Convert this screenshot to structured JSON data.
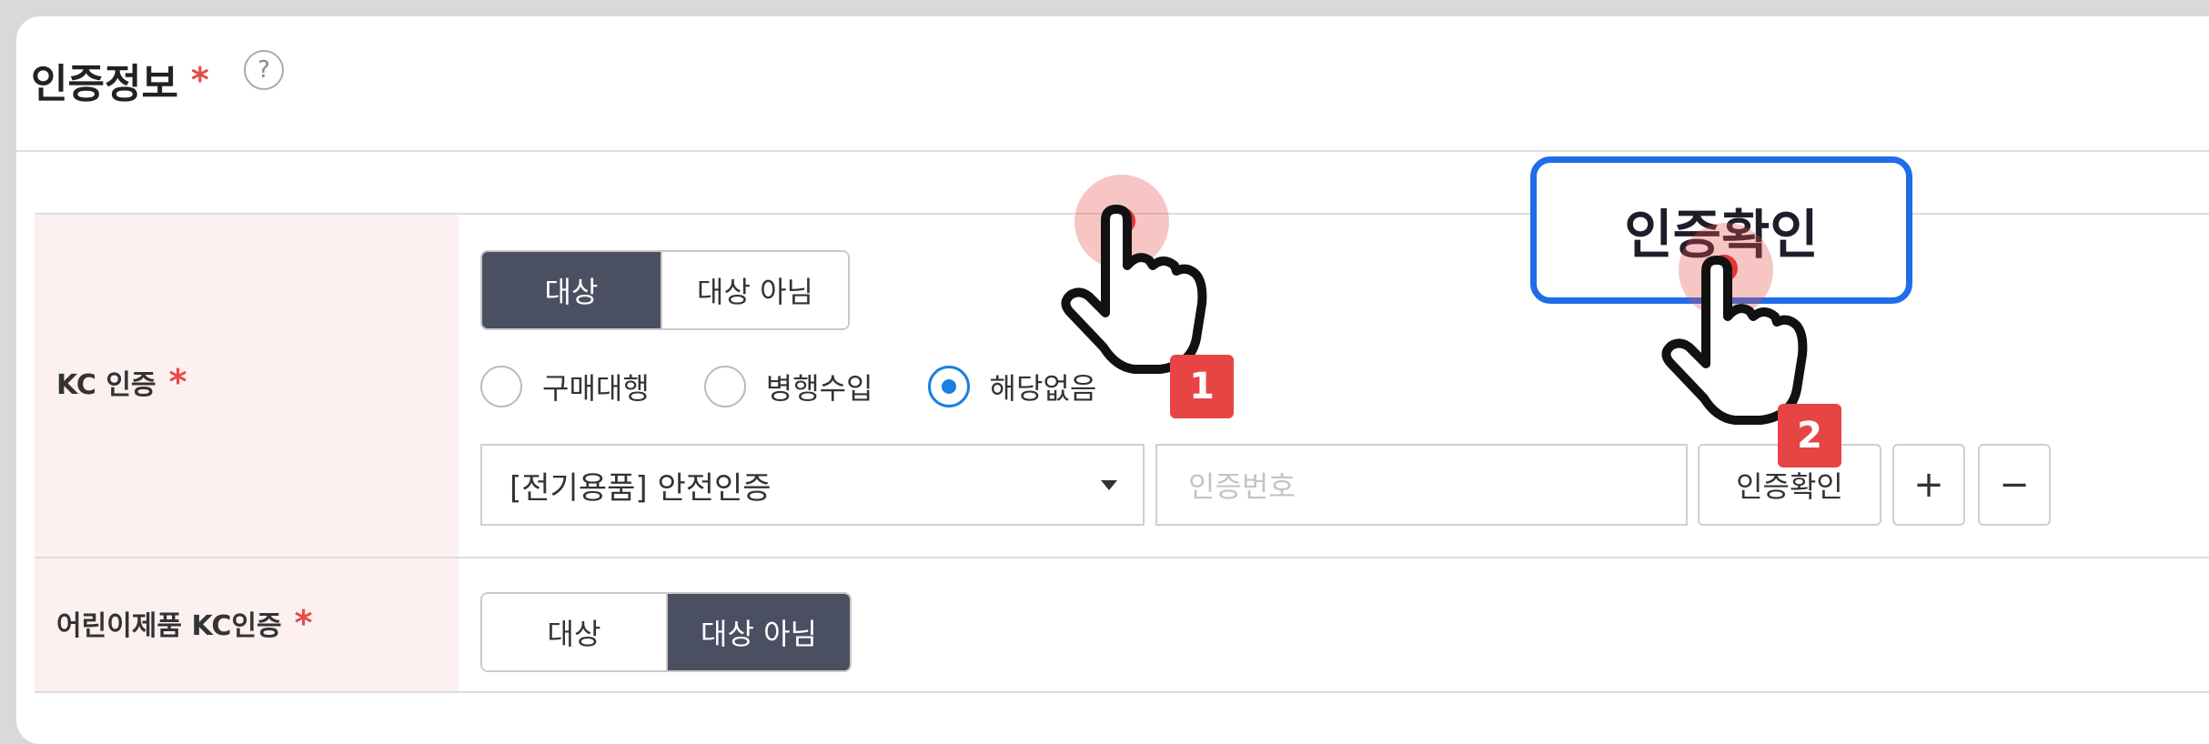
{
  "section": {
    "title": "인증정보",
    "required_mark": "*",
    "help_icon_glyph": "?"
  },
  "kc": {
    "label": "KC 인증",
    "required_mark": "*",
    "toggle": {
      "options": [
        "대상",
        "대상 아님"
      ],
      "selected": "대상"
    },
    "radios": [
      {
        "label": "구매대행",
        "checked": false
      },
      {
        "label": "병행수입",
        "checked": false
      },
      {
        "label": "해당없음",
        "checked": true
      }
    ],
    "category_select": {
      "value": "[전기용품] 안전인증"
    },
    "cert_number": {
      "value": "",
      "placeholder": "인증번호"
    },
    "verify_button": "인증확인",
    "add_button": "+",
    "remove_button": "−"
  },
  "kids_kc": {
    "label": "어린이제품 KC인증",
    "required_mark": "*",
    "toggle": {
      "options": [
        "대상",
        "대상 아님"
      ],
      "selected": "대상 아님"
    }
  },
  "overlay": {
    "callout_text": "인증확인",
    "step_markers": [
      "1",
      "2"
    ],
    "colors": {
      "marker": "#e74444",
      "callout_border": "#1f6de8",
      "toggle_active": "#4a5061",
      "radio_selected": "#1a7fe0"
    }
  }
}
